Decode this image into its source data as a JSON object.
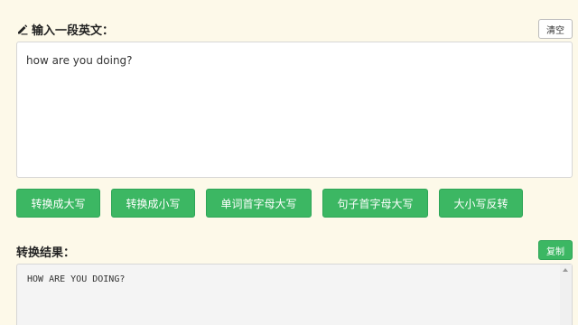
{
  "input": {
    "title": "输入一段英文：",
    "clear_label": "清空",
    "value": "how are you doing?"
  },
  "buttons": [
    {
      "label": "转换成大写"
    },
    {
      "label": "转换成小写"
    },
    {
      "label": "单词首字母大写"
    },
    {
      "label": "句子首字母大写"
    },
    {
      "label": "大小写反转"
    }
  ],
  "result": {
    "title": "转换结果：",
    "copy_label": "复制",
    "value": "HOW ARE YOU DOING?"
  },
  "icons": {
    "title_icon": "pencil-icon",
    "scroll_icon": "scroll-up-arrow-icon"
  },
  "colors": {
    "accent": "#3cb763",
    "background": "#fdf9e9"
  }
}
